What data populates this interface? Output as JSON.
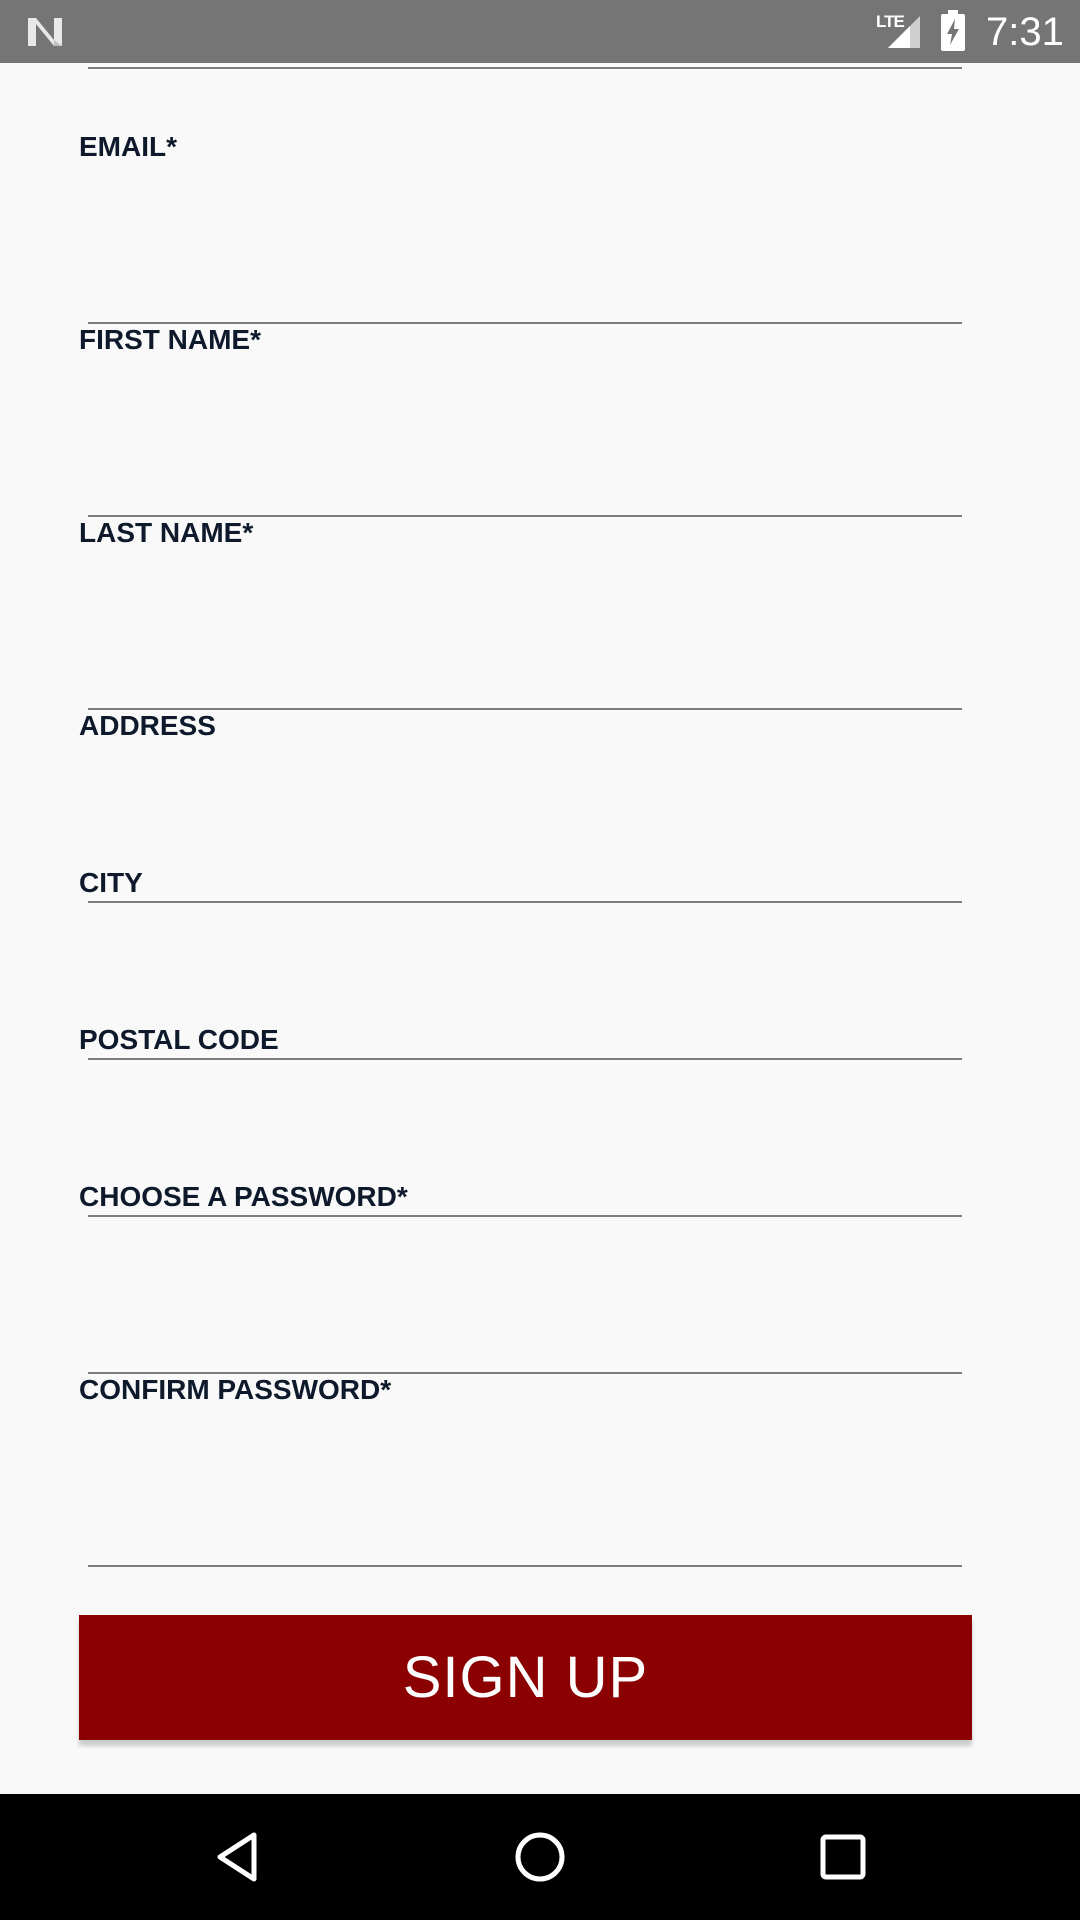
{
  "status_bar": {
    "network": "LTE",
    "time": "7:31",
    "icons": [
      "android-n-logo-icon",
      "signal-icon",
      "battery-charging-icon"
    ]
  },
  "form": {
    "fields": [
      {
        "label": "EMAIL*",
        "value": ""
      },
      {
        "label": "FIRST NAME*",
        "value": ""
      },
      {
        "label": "LAST NAME*",
        "value": ""
      },
      {
        "label": "ADDRESS",
        "value": ""
      },
      {
        "label": "CITY",
        "value": ""
      },
      {
        "label": "POSTAL CODE",
        "value": ""
      },
      {
        "label": "CHOOSE A PASSWORD*",
        "value": ""
      },
      {
        "label": "CONFIRM PASSWORD*",
        "value": ""
      }
    ],
    "submit_label": "SIGN UP"
  },
  "nav_bar": {
    "icons": [
      "back-icon",
      "home-icon",
      "recents-icon"
    ]
  },
  "colors": {
    "accent": "#8b0000",
    "status_bar": "#757575",
    "background": "#f9f9f9",
    "label_text": "#0e1a2b"
  }
}
